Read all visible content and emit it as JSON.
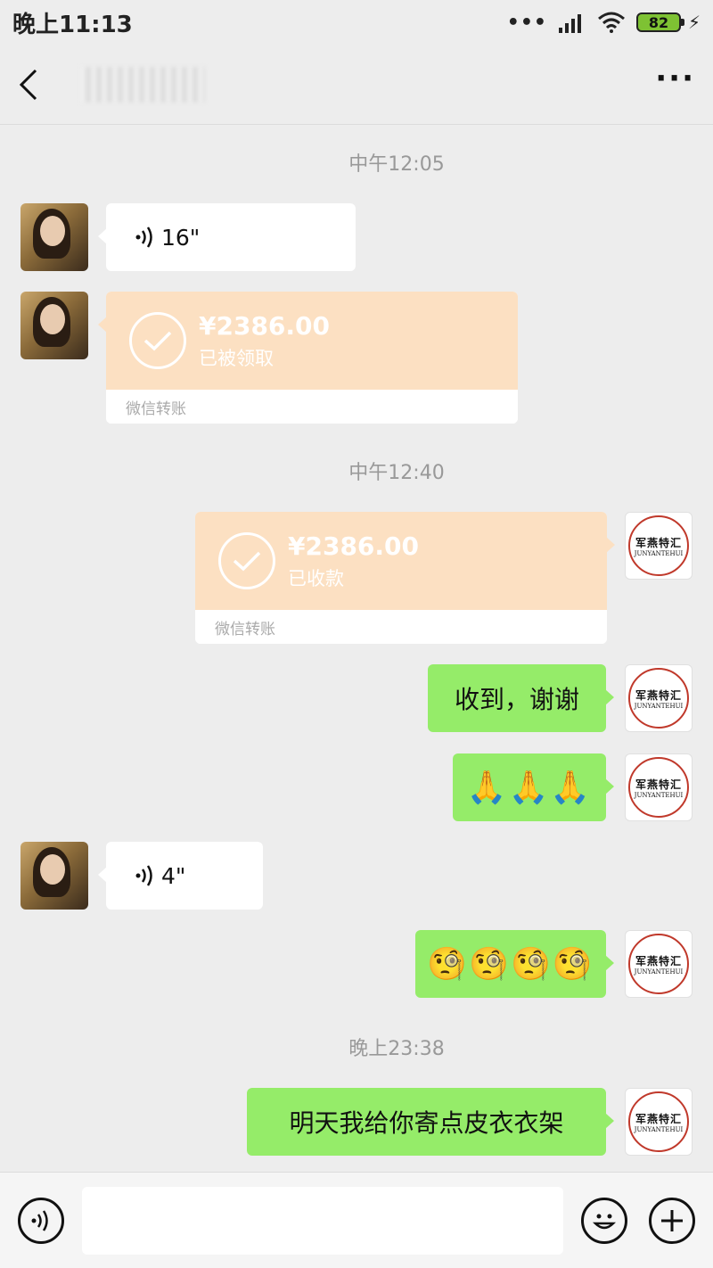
{
  "status_bar": {
    "time": "晚上11:13",
    "battery": "82",
    "signal_dots": "•••"
  },
  "header": {
    "title": "",
    "more": "···"
  },
  "messages": {
    "ts1": "中午12:05",
    "voice1": "16\"",
    "transfer1": {
      "amount": "¥2386.00",
      "status": "已被领取",
      "footer": "微信转账"
    },
    "ts2": "中午12:40",
    "transfer2": {
      "amount": "¥2386.00",
      "status": "已收款",
      "footer": "微信转账"
    },
    "text1": "收到，谢谢",
    "emoji1": "🙏🙏🙏",
    "voice2": "4\"",
    "emoji2": "🧐🧐🧐🧐",
    "ts3": "晚上23:38",
    "text2": "明天我给你寄点皮衣衣架"
  },
  "my_avatar": {
    "logo_cn": "军燕特汇",
    "logo_en": "JUNYANTEHUI"
  },
  "input_bar": {
    "value": "",
    "placeholder": ""
  },
  "colors": {
    "sent_bubble": "#95ec69",
    "transfer_card": "#fce0c2",
    "background": "#ededed"
  }
}
